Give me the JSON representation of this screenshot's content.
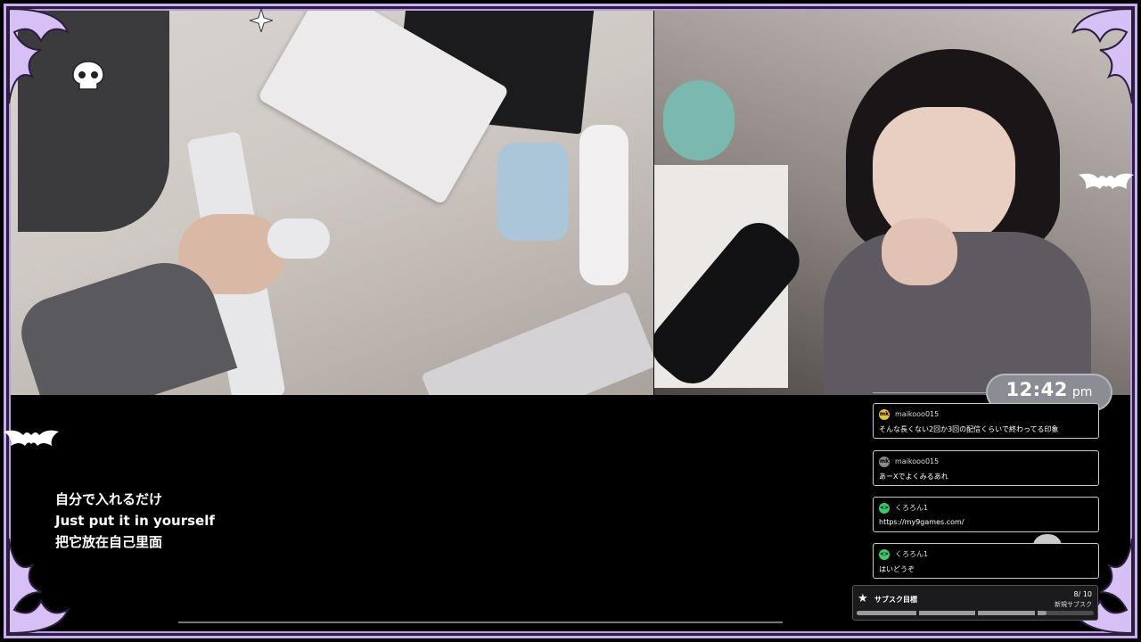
{
  "overlay": {
    "subtitles": {
      "japanese": "自分で入れるだけ",
      "english": "Just put it in yourself",
      "chinese": "把它放在自己里面"
    },
    "clock": {
      "time": "12:42",
      "ampm": "pm"
    },
    "chat": {
      "messages": [
        {
          "user": "maikooo015",
          "avatar_text": "mk",
          "avatar_color": "#e5c23a",
          "text": "そんな長くない2回か3回の配信くらいで終わってる印象"
        },
        {
          "user": "maikooo015",
          "avatar_text": "mk",
          "avatar_color": "#8a8a8a",
          "text": "あーXでよくみるあれ"
        },
        {
          "user": "くろろん1",
          "avatar_text": "<>",
          "avatar_color": "#3ec96b",
          "text": "https://my9games.com/"
        },
        {
          "user": "くろろん1",
          "avatar_text": "<>",
          "avatar_color": "#3ec96b",
          "text": "はいどうぞ"
        }
      ]
    },
    "sub_goal": {
      "title": "サブスク目標",
      "count": "8/ 10",
      "subtitle": "新規サブスク",
      "progress": 0.8,
      "icon": "star-icon"
    }
  },
  "colors": {
    "frame_lilac": "#c8aef0",
    "clock_bg": "#8c8d94"
  }
}
